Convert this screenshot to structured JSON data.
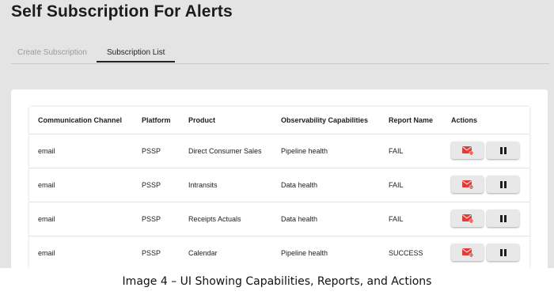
{
  "page": {
    "title": "Self Subscription For Alerts",
    "caption": "Image 4 – UI Showing Capabilities, Reports, and Actions"
  },
  "tabs": [
    {
      "label": "Create Subscription",
      "active": false
    },
    {
      "label": "Subscription List",
      "active": true
    }
  ],
  "table": {
    "headers": {
      "channel": "Communication Channel",
      "platform": "Platform",
      "product": "Product",
      "capabilities": "Observability Capabilities",
      "report": "Report Name",
      "actions": "Actions"
    },
    "rows": [
      {
        "channel": "email",
        "platform": "PSSP",
        "product": "Direct Consumer Sales",
        "capabilities": "Pipeline health",
        "report": "FAIL"
      },
      {
        "channel": "email",
        "platform": "PSSP",
        "product": "Intransits",
        "capabilities": "Data health",
        "report": "FAIL"
      },
      {
        "channel": "email",
        "platform": "PSSP",
        "product": "Receipts Actuals",
        "capabilities": "Data health",
        "report": "FAIL"
      },
      {
        "channel": "email",
        "platform": "PSSP",
        "product": "Calendar",
        "capabilities": "Pipeline health",
        "report": "SUCCESS"
      }
    ],
    "action_icons": {
      "unsubscribe": "mail-remove-icon",
      "pause": "pause-icon"
    }
  },
  "colors": {
    "background": "#e4e4e4",
    "accent_red": "#e53935",
    "button_bg": "#e8e8e8"
  }
}
